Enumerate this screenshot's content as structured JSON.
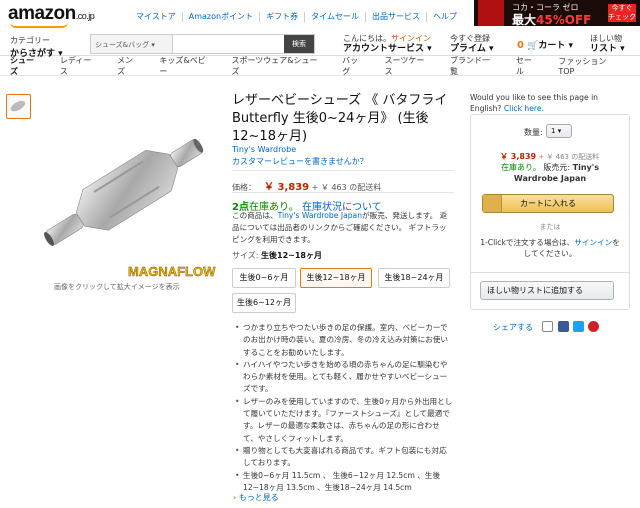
{
  "header": {
    "logo": "amazon",
    "logo_domain": ".co.jp",
    "top_links": [
      "マイストア",
      "Amazonポイント",
      "ギフト券",
      "タイムセール",
      "出品サービス",
      "ヘルプ"
    ],
    "category_small": "カテゴリー",
    "category_big": "からさがす",
    "search_dropdown": "シューズ&バッグ",
    "search_button": "検索",
    "greeting": "こんにちは。",
    "signin": "サインイン",
    "account": "アカウントサービス",
    "prime_small": "今すぐ登録",
    "prime": "プライム",
    "cart_count": "0",
    "cart": "カート",
    "wishlist_small": "ほしい物",
    "wishlist": "リスト"
  },
  "promo": {
    "line1": "コカ・コーラ ゼロ",
    "line2_prefix": "最大",
    "line2_value": "45%OFF",
    "badge": "今すぐ チェック"
  },
  "nav": [
    "シューズ",
    "レディース",
    "メンズ",
    "キッズ&ベビー",
    "スポーツウェア&シューズ",
    "バッグ",
    "スーツケース",
    "ブランド一覧",
    "セール",
    "ファッションTOP"
  ],
  "product": {
    "image_caption": "画像をクリックして拡大イメージを表示",
    "image_brand_text": "MAGNAFLOW",
    "title": "レザーベビーシューズ 《 バタフライ Butterfly 生後0~24ヶ月》 (生後12~18ヶ月)",
    "brand": "Tiny's Wardrobe",
    "review_link": "カスタマーレビューを書きませんか？",
    "price_label": "価格：",
    "price": "￥ 3,839",
    "shipping": "+ ￥ 463 の配送料",
    "stock_count": "2点",
    "stock_text": "在庫あり。",
    "stock_link": "在庫状況について",
    "sold_prefix": "この商品は、",
    "sold_seller": "Tiny's Wardrobe Japan",
    "sold_suffix": "が販売、発送します。 返品については出品者のリンクからご確認ください。 ギフトラッピングを利用できます。",
    "size_label": "サイズ:",
    "size_value": "生後12~18ヶ月",
    "sizes": [
      "生後0~6ヶ月",
      "生後12~18ヶ月",
      "生後18~24ヶ月",
      "生後6~12ヶ月"
    ],
    "bullets": [
      "つかまり立ちやつたい歩きの足の保護。室内、ベビーカーでのお出かけ時の装い。夏の冷房、冬の冷え込み対策にお使いすることをお勧めいたします。",
      "ハイハイやつたい歩きを始める頃の赤ちゃんの足に馴染むやわらか素材を使用。とても軽く、履かせやすいベビーシューズです。",
      "レザーのみを使用していますので、生後0ヶ月から外出用として履いていただけます。『ファーストシューズ』として最適です。レザーの最適な柔軟さは、赤ちゃんの足の形に合わせて、やさしくフィットします。",
      "贈り物としても大変喜ばれる商品です。ギフト包装にも対応しております。",
      "生後0~6ヶ月 11.5cm 、 生後6~12ヶ月 12.5cm 、生後12~18ヶ月 13.5cm 、生後18~24ヶ月 14.5cm"
    ],
    "more": "もっと見る"
  },
  "buybox": {
    "english_q": "Would you like to see this page in English?",
    "english_link": "Click here.",
    "qty_label": "数量:",
    "qty_value": "1",
    "price": "￥ 3,839",
    "shipping": "+ ￥ 463 の配送料",
    "stock": "在庫あり。",
    "seller_label": "販売元:",
    "seller": "Tiny's Wardrobe Japan",
    "add_to_cart": "カートに入れる",
    "or": "または",
    "oneclick_text": "1-Clickで注文する場合は、",
    "oneclick_link": "サインイン",
    "oneclick_suffix": "をしてください。",
    "wishlist_btn": "ほしい物リストに追加する",
    "share": "シェアする"
  }
}
